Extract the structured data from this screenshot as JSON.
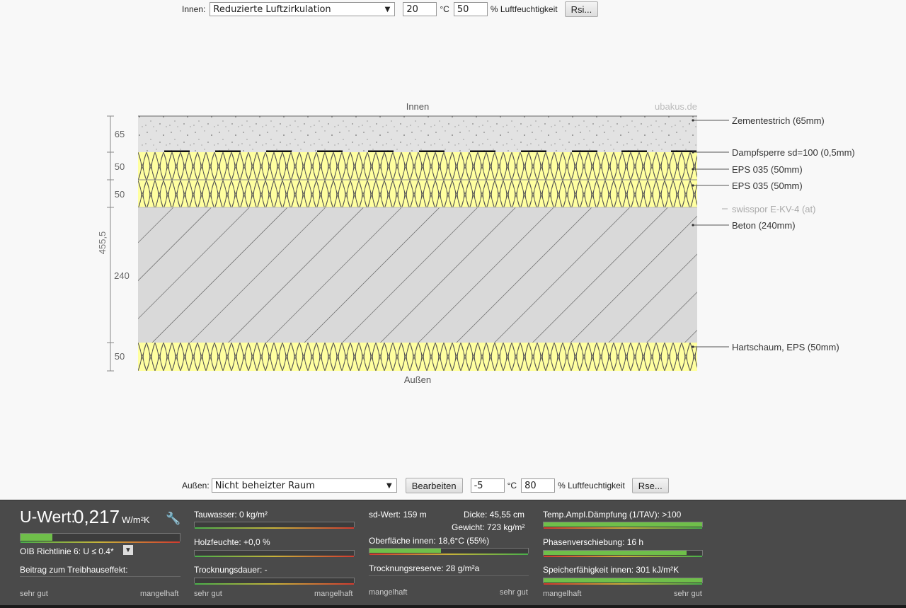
{
  "inner": {
    "label": "Innen:",
    "select": "Reduzierte Luftzirkulation",
    "temp": "20",
    "temp_unit": "°C",
    "humidity": "50",
    "humidity_unit": "% Luftfeuchtigkeit",
    "button": "Rsi..."
  },
  "outer": {
    "label": "Außen:",
    "select": "Nicht beheizter Raum",
    "edit_button": "Bearbeiten",
    "temp": "-5",
    "temp_unit": "°C",
    "humidity": "80",
    "humidity_unit": "% Luftfeuchtigkeit",
    "button": "Rse..."
  },
  "diagram": {
    "top_label": "Innen",
    "bottom_label": "Außen",
    "watermark": "ubakus.de",
    "total_thickness": "455,5",
    "layers": [
      {
        "thickness": "65",
        "label": "Zementestrich (65mm)"
      },
      {
        "thickness": "",
        "label": "Dampfsperre sd=100 (0,5mm)"
      },
      {
        "thickness": "50",
        "label": "EPS 035 (50mm)"
      },
      {
        "thickness": "50",
        "label": "EPS 035 (50mm)"
      },
      {
        "thickness": "",
        "label": "swisspor E-KV-4 (at)"
      },
      {
        "thickness": "240",
        "label": "Beton (240mm)"
      },
      {
        "thickness": "50",
        "label": "Hartschaum, EPS (50mm)"
      }
    ]
  },
  "panel": {
    "uwert_label": "U-Wert:",
    "uwert_value": "0,217",
    "uwert_unit": "W/m²K",
    "uwert_fill": 0.2,
    "oib": "OIB Richtlinie 6: U ≤ 0.4*",
    "treibhaus": "Beitrag zum Treibhauseffekt:",
    "scale_good": "sehr gut",
    "scale_bad": "mangelhaft",
    "tauwasser": "Tauwasser: 0 kg/m²",
    "holzfeuchte": "Holzfeuchte: +0,0 %",
    "trocknungsdauer": "Trocknungsdauer: -",
    "sd_wert": "sd-Wert: 159 m",
    "dicke": "Dicke: 45,55 cm",
    "gewicht": "Gewicht: 723 kg/m²",
    "oberflaeche": "Oberfläche innen: 18,6°C (55%)",
    "oberflaeche_fill": 0.45,
    "trocknungsreserve": "Trocknungsreserve: 28 g/m²a",
    "temp_ampl": "Temp.Ampl.Dämpfung (1/TAV): >100",
    "temp_ampl_fill": 1.0,
    "phasen": "Phasenverschiebung: 16 h",
    "phasen_fill": 0.9,
    "speicher": "Speicherfähigkeit innen: 301 kJ/m²K",
    "speicher_fill": 1.0
  }
}
